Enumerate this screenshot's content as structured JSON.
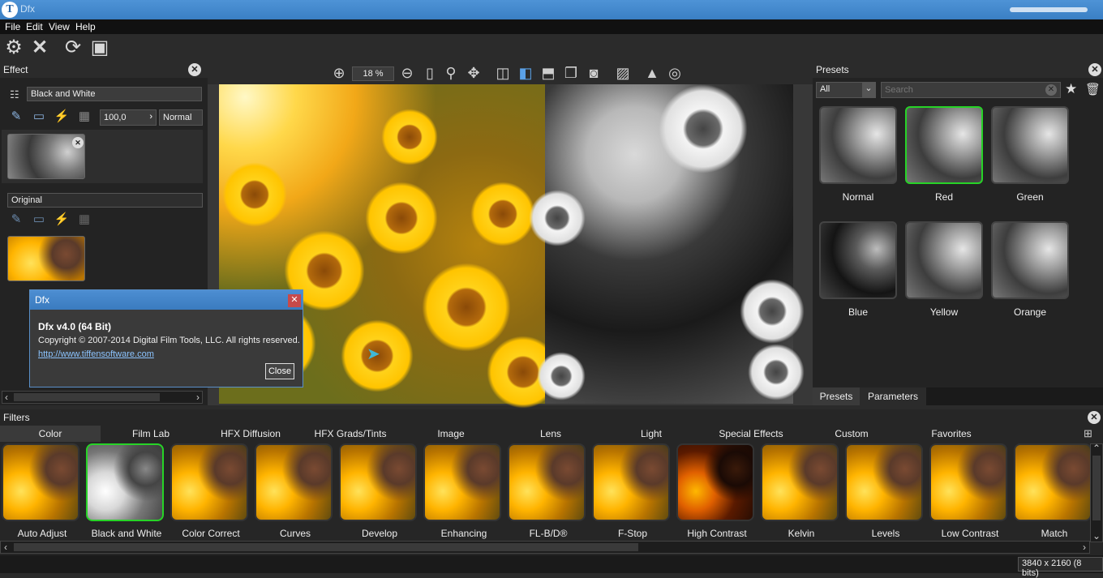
{
  "window": {
    "title": "Dfx",
    "logo": "T"
  },
  "menu": [
    "File",
    "Edit",
    "View",
    "Help"
  ],
  "toolbar_icons": [
    "gear-icon",
    "close-icon",
    "refresh-icon",
    "fit-icon"
  ],
  "effect": {
    "header": "Effect",
    "layer_name": "Black and White",
    "opacity": "100,0",
    "blend": "Normal",
    "original_label": "Original"
  },
  "canvas": {
    "zoom": "18 %"
  },
  "presets": {
    "header": "Presets",
    "category": "All",
    "search_placeholder": "Search",
    "items": [
      {
        "label": "Normal",
        "selected": false
      },
      {
        "label": "Red",
        "selected": true
      },
      {
        "label": "Green",
        "selected": false
      },
      {
        "label": "Blue",
        "selected": false
      },
      {
        "label": "Yellow",
        "selected": false
      },
      {
        "label": "Orange",
        "selected": false
      }
    ],
    "tabs": [
      "Presets",
      "Parameters"
    ]
  },
  "filters": {
    "header": "Filters",
    "tabs": [
      "Color",
      "Film Lab",
      "HFX Diffusion",
      "HFX Grads/Tints",
      "Image",
      "Lens",
      "Light",
      "Special Effects",
      "Custom",
      "Favorites"
    ],
    "items": [
      "Auto Adjust",
      "Black and White",
      "Color Correct",
      "Curves",
      "Develop",
      "Enhancing",
      "FL-B/D®",
      "F-Stop",
      "High Contrast",
      "Kelvin",
      "Levels",
      "Low Contrast",
      "Match"
    ],
    "selected": "Black and White"
  },
  "dialog": {
    "title": "Dfx",
    "version": "Dfx v4.0 (64 Bit)",
    "copyright": "Copyright © 2007-2014 Digital Film Tools, LLC. All rights reserved.",
    "link": "http://www.tiffensoftware.com",
    "close_label": "Close"
  },
  "status": {
    "info": "3840 x 2160 (8 bits)"
  },
  "colors": {
    "accent": "#4e93d6",
    "select_green": "#27d327"
  }
}
